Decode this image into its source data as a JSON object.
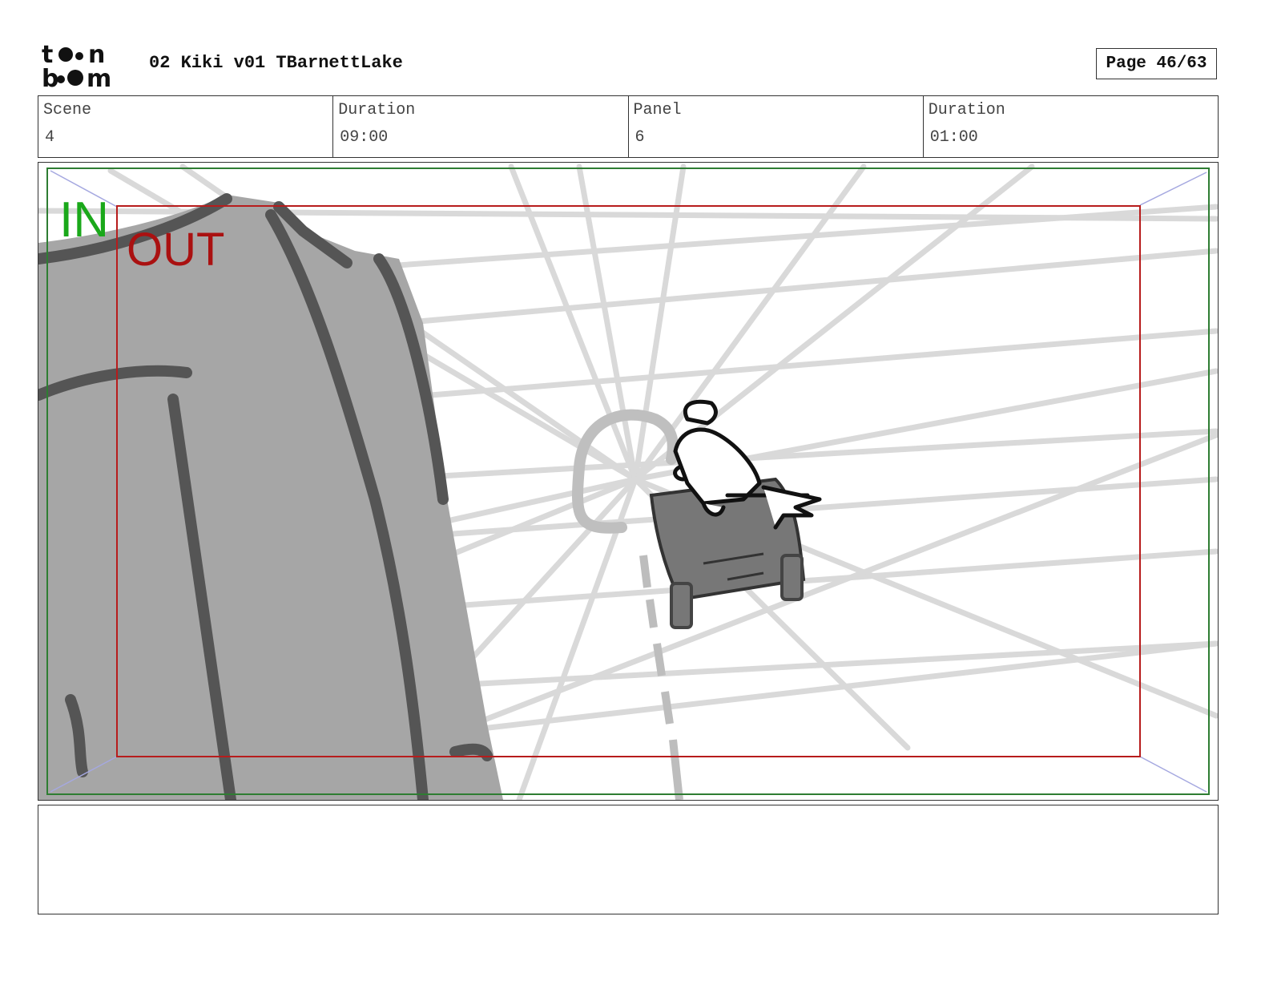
{
  "header": {
    "logo_icon": "toonboom-logo",
    "logo_text": "toon boom",
    "title": "02 Kiki v01 TBarnettLake",
    "page": "Page 46/63"
  },
  "info": [
    {
      "label": "Scene",
      "value": "4"
    },
    {
      "label": "Duration",
      "value": "09:00"
    },
    {
      "label": "Panel",
      "value": "6"
    },
    {
      "label": "Duration",
      "value": "01:00"
    }
  ],
  "panel": {
    "in_label": "IN",
    "out_label": "OUT",
    "in_color": "#1aa81a",
    "out_color": "#aa1111",
    "in_frame_color": "#2e7d32",
    "out_frame_color": "#b71c1c"
  },
  "notes": {
    "text": ""
  }
}
